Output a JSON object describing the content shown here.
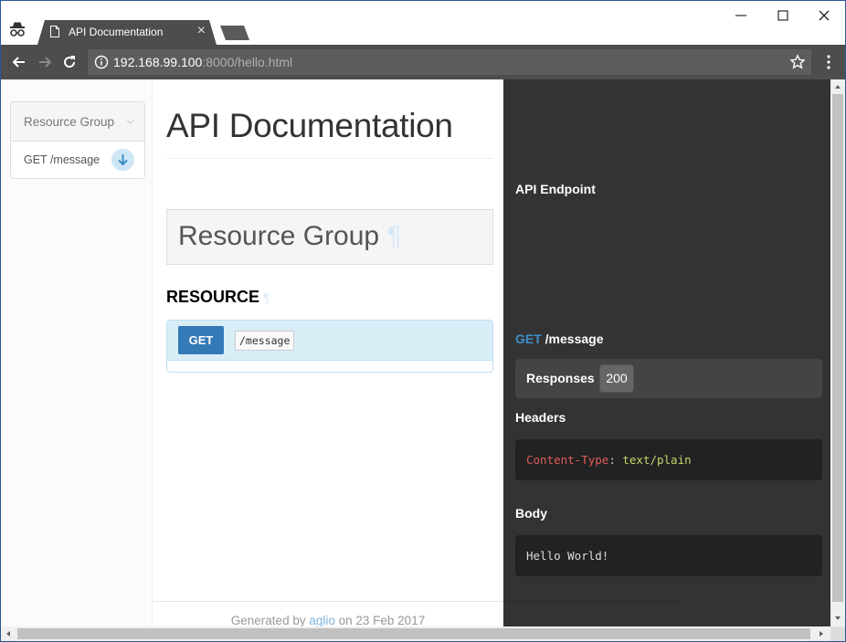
{
  "browser": {
    "tab_title": "API Documentation",
    "tab_close": "×",
    "url_host": "192.168.99.100",
    "url_rest": ":8000/hello.html",
    "icons": {
      "incognito": "incognito-icon",
      "page": "page-icon",
      "back": "back-arrow-icon",
      "forward": "forward-arrow-icon",
      "reload": "reload-icon",
      "info": "info-icon",
      "star": "star-icon",
      "menu": "kebab-menu-icon",
      "minimize": "minimize-icon",
      "maximize": "maximize-icon",
      "close": "close-icon"
    }
  },
  "nav": {
    "group_label": "Resource Group",
    "items": [
      {
        "label": "GET /message",
        "icon": "arrow-down-icon"
      }
    ]
  },
  "content": {
    "title": "API Documentation",
    "group_title": "Resource Group",
    "pilcrow": "¶",
    "resource_title": "RESOURCE",
    "action": {
      "method": "GET",
      "uri": "/message"
    },
    "footer": {
      "prefix": "Generated by ",
      "link": "aglio",
      "suffix": " on 23 Feb 2017"
    }
  },
  "example": {
    "endpoint_label": "API Endpoint",
    "method": "GET",
    "uri": " /message",
    "responses_label": "Responses",
    "status": "200",
    "headers_label": "Headers",
    "header_key": "Content-Type",
    "header_colon": ": ",
    "header_value": "text/plain",
    "body_label": "Body",
    "body": "Hello World!"
  },
  "colors": {
    "accent": "#337ab7",
    "right_panel": "#333333",
    "code_bg": "#222222",
    "header_key": "#e05b5b",
    "header_value": "#c9d36a"
  }
}
